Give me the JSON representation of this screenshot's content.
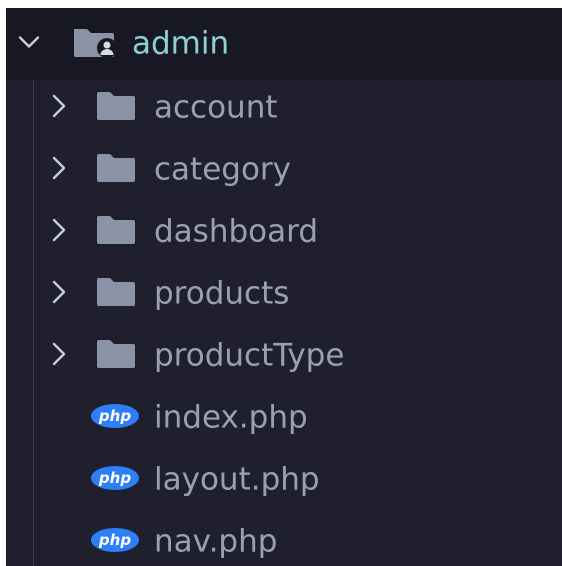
{
  "root": {
    "label": "admin",
    "expanded": true,
    "icon": "folder-admin-open-icon"
  },
  "items": [
    {
      "label": "account",
      "kind": "folder",
      "icon": "folder-icon"
    },
    {
      "label": "category",
      "kind": "folder",
      "icon": "folder-icon"
    },
    {
      "label": "dashboard",
      "kind": "folder",
      "icon": "folder-icon"
    },
    {
      "label": "products",
      "kind": "folder",
      "icon": "folder-icon"
    },
    {
      "label": "productType",
      "kind": "folder",
      "icon": "folder-icon"
    },
    {
      "label": "index.php",
      "kind": "file",
      "icon": "php-file-icon"
    },
    {
      "label": "layout.php",
      "kind": "file",
      "icon": "php-file-icon"
    },
    {
      "label": "nav.php",
      "kind": "file",
      "icon": "php-file-icon"
    }
  ],
  "php_badge_text": "php",
  "colors": {
    "background": "#1f1f2e",
    "header_background": "#181825",
    "root_label": "#8ed1d0",
    "item_label": "#9aa0b4",
    "folder": "#8a94a6",
    "php_badge": "#2d7ef7",
    "chevron": "#c9ccd6"
  }
}
